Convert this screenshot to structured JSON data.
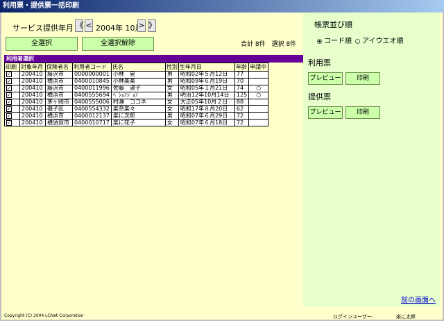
{
  "window": {
    "title": "利用票・提供票一括印刷"
  },
  "service": {
    "label": "サービス提供年月",
    "first": "《",
    "prev": "<",
    "date": "2004年 10月",
    "next": ">",
    "last": "》"
  },
  "buttons": {
    "select_all": "全選択",
    "deselect_all": "全選択解除"
  },
  "totals": {
    "text": "合計 8件　選択 8件"
  },
  "table": {
    "title": "利用者選択",
    "headers": [
      "印刷",
      "対象年月",
      "保険者名",
      "利用者コード",
      "氏名",
      "性別",
      "生年月日",
      "年齢",
      "申請中"
    ],
    "rows": [
      {
        "checked": "✓",
        "ym": "200410",
        "insurer": "藤沢市",
        "code": "0000000001",
        "name": "小林　晃",
        "sex": "男",
        "birth": "昭和02年５月12日",
        "age": "77",
        "applying": ""
      },
      {
        "checked": "✓",
        "ym": "200410",
        "insurer": "横浜市",
        "code": "0400010845",
        "name": "小林楽楽",
        "sex": "男",
        "birth": "昭和09年６月19日",
        "age": "70",
        "applying": ""
      },
      {
        "checked": "✓",
        "ym": "200410",
        "insurer": "藤沢市",
        "code": "0400011996",
        "name": "佐藤　淑子",
        "sex": "女",
        "birth": "昭和05年１月21日",
        "age": "74",
        "applying": "○"
      },
      {
        "checked": "✓",
        "ym": "200410",
        "insurer": "横浜市",
        "code": "0400555694",
        "name": "ﾍﾟｼｮﾝｼﾞｮﾝ",
        "sex": "男",
        "birth": "明治12年10月14日",
        "age": "125",
        "applying": "○"
      },
      {
        "checked": "✓",
        "ym": "200410",
        "insurer": "茅ヶ崎市",
        "code": "0400555006",
        "name": "村瀬　ココネ",
        "sex": "女",
        "birth": "大正05年10月２日",
        "age": "88",
        "applying": ""
      },
      {
        "checked": "✓",
        "ym": "200410",
        "insurer": "磯子区",
        "code": "0400554332",
        "name": "楽奈楽々",
        "sex": "女",
        "birth": "昭和17年８月20日",
        "age": "62",
        "applying": ""
      },
      {
        "checked": "✓",
        "ym": "200410",
        "insurer": "横浜市",
        "code": "0400012137",
        "name": "楽に次郎",
        "sex": "男",
        "birth": "昭和07年６月29日",
        "age": "72",
        "applying": ""
      },
      {
        "checked": "✓",
        "ym": "200410",
        "insurer": "横須賀市",
        "code": "0400010717",
        "name": "楽に花子",
        "sex": "女",
        "birth": "昭和07年６月18日",
        "age": "72",
        "applying": ""
      }
    ]
  },
  "sort": {
    "title": "帳票並び順",
    "opt1": "コード順",
    "opt2": "アイウエオ順",
    "selected": "コード順"
  },
  "riyouhyou": {
    "title": "利用票",
    "preview": "プレビュー",
    "print": "印刷"
  },
  "teikyouhyou": {
    "title": "提供票",
    "preview": "プレビュー",
    "print": "印刷"
  },
  "footer": {
    "back": "前の画面へ",
    "copyright": "Copyright (C) 2004 LCNet Corporation",
    "login_label": "ログインユーザー:",
    "login_user": "楽に太郎"
  }
}
